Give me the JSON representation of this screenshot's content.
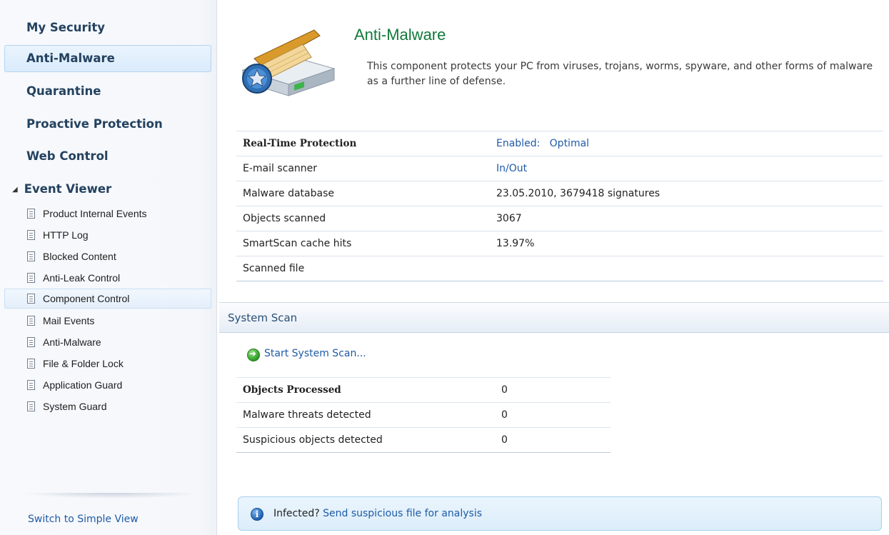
{
  "sidebar": {
    "nav": [
      {
        "label": "My Security"
      },
      {
        "label": "Anti-Malware",
        "selected": true
      },
      {
        "label": "Quarantine"
      },
      {
        "label": "Proactive Protection"
      },
      {
        "label": "Web Control"
      }
    ],
    "event_viewer": {
      "label": "Event Viewer",
      "items": [
        {
          "label": "Product Internal Events"
        },
        {
          "label": "HTTP Log"
        },
        {
          "label": "Blocked Content"
        },
        {
          "label": "Anti-Leak Control"
        },
        {
          "label": "Component Control",
          "selected": true
        },
        {
          "label": "Mail Events"
        },
        {
          "label": "Anti-Malware"
        },
        {
          "label": "File & Folder Lock"
        },
        {
          "label": "Application Guard"
        },
        {
          "label": "System Guard"
        }
      ]
    },
    "switch_view_label": "Switch to Simple View"
  },
  "main": {
    "title": "Anti-Malware",
    "description": "This component protects your PC from viruses, trojans, worms, spyware,  and other forms of malware as a further line of defense.",
    "status": {
      "rtp_label": "Real-Time Protection",
      "rtp_enabled": "Enabled:",
      "rtp_level": "Optimal",
      "email_label": "E-mail scanner",
      "email_value": "In/Out",
      "db_label": "Malware database",
      "db_value": "23.05.2010, 3679418 signatures",
      "objects_label": "Objects scanned",
      "objects_value": "3067",
      "cache_label": "SmartScan cache hits",
      "cache_value": "13.97%",
      "file_label": "Scanned file",
      "file_value": ""
    },
    "system_scan": {
      "title": "System Scan",
      "start_label": "Start System Scan...",
      "processed_label": "Objects Processed",
      "processed_value": "0",
      "threats_label": "Malware threats detected",
      "threats_value": "0",
      "suspicious_label": "Suspicious objects detected",
      "suspicious_value": "0"
    },
    "infected_bar": {
      "prefix": "Infected?",
      "link": "Send suspicious file for analysis"
    }
  },
  "colors": {
    "accent_green": "#117a3a",
    "link_blue": "#1f5aa6",
    "nav_text": "#24425f"
  }
}
